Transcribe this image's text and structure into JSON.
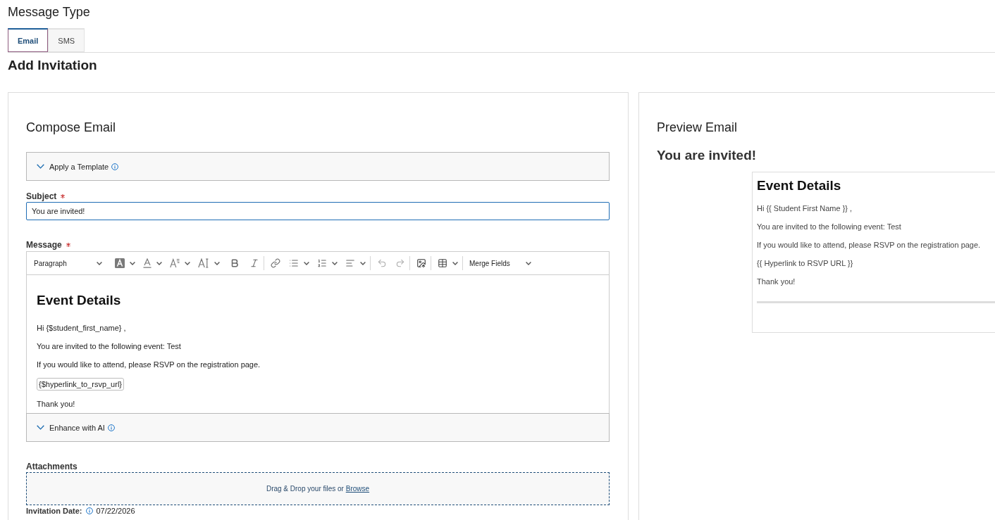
{
  "message_type": {
    "title": "Message Type",
    "tabs": [
      {
        "label": "Email",
        "selected": true
      },
      {
        "label": "SMS",
        "selected": false
      }
    ]
  },
  "page_title": "Add Invitation",
  "compose": {
    "title": "Compose Email",
    "template_section": {
      "label": "Apply a Template",
      "expanded": false
    },
    "subject": {
      "label": "Subject",
      "required": true,
      "value": "You are invited!"
    },
    "message": {
      "label": "Message",
      "required": true,
      "toolbar": {
        "block_format": "Paragraph",
        "merge_fields": "Merge Fields"
      },
      "content": {
        "heading": "Event Details",
        "paragraphs": [
          {
            "kind": "text",
            "text": "Hi {$student_first_name} ,"
          },
          {
            "kind": "text",
            "text": "You are invited to the following event: Test"
          },
          {
            "kind": "text",
            "text": "If you would like to attend, please RSVP on the registration page."
          },
          {
            "kind": "merge_tag",
            "text": "{$hyperlink_to_rsvp_url}"
          },
          {
            "kind": "text",
            "text": "Thank you!"
          }
        ]
      }
    },
    "ai_section": {
      "label": "Enhance with AI",
      "expanded": false
    },
    "attachments": {
      "label": "Attachments",
      "drop_text": "Drag & Drop your files or",
      "browse_link": "Browse"
    },
    "invitation_date": {
      "label": "Invitation Date:",
      "value": "07/22/2026"
    }
  },
  "preview": {
    "title": "Preview Email",
    "subject": "You are invited!",
    "heading": "Event Details",
    "paragraphs": [
      "Hi {{ Student First Name }} ,",
      "You are invited to the following event: Test",
      "If you would like to attend, please RSVP on the registration page.",
      "{{ Hyperlink to RSVP URL }}",
      "Thank you!"
    ]
  }
}
